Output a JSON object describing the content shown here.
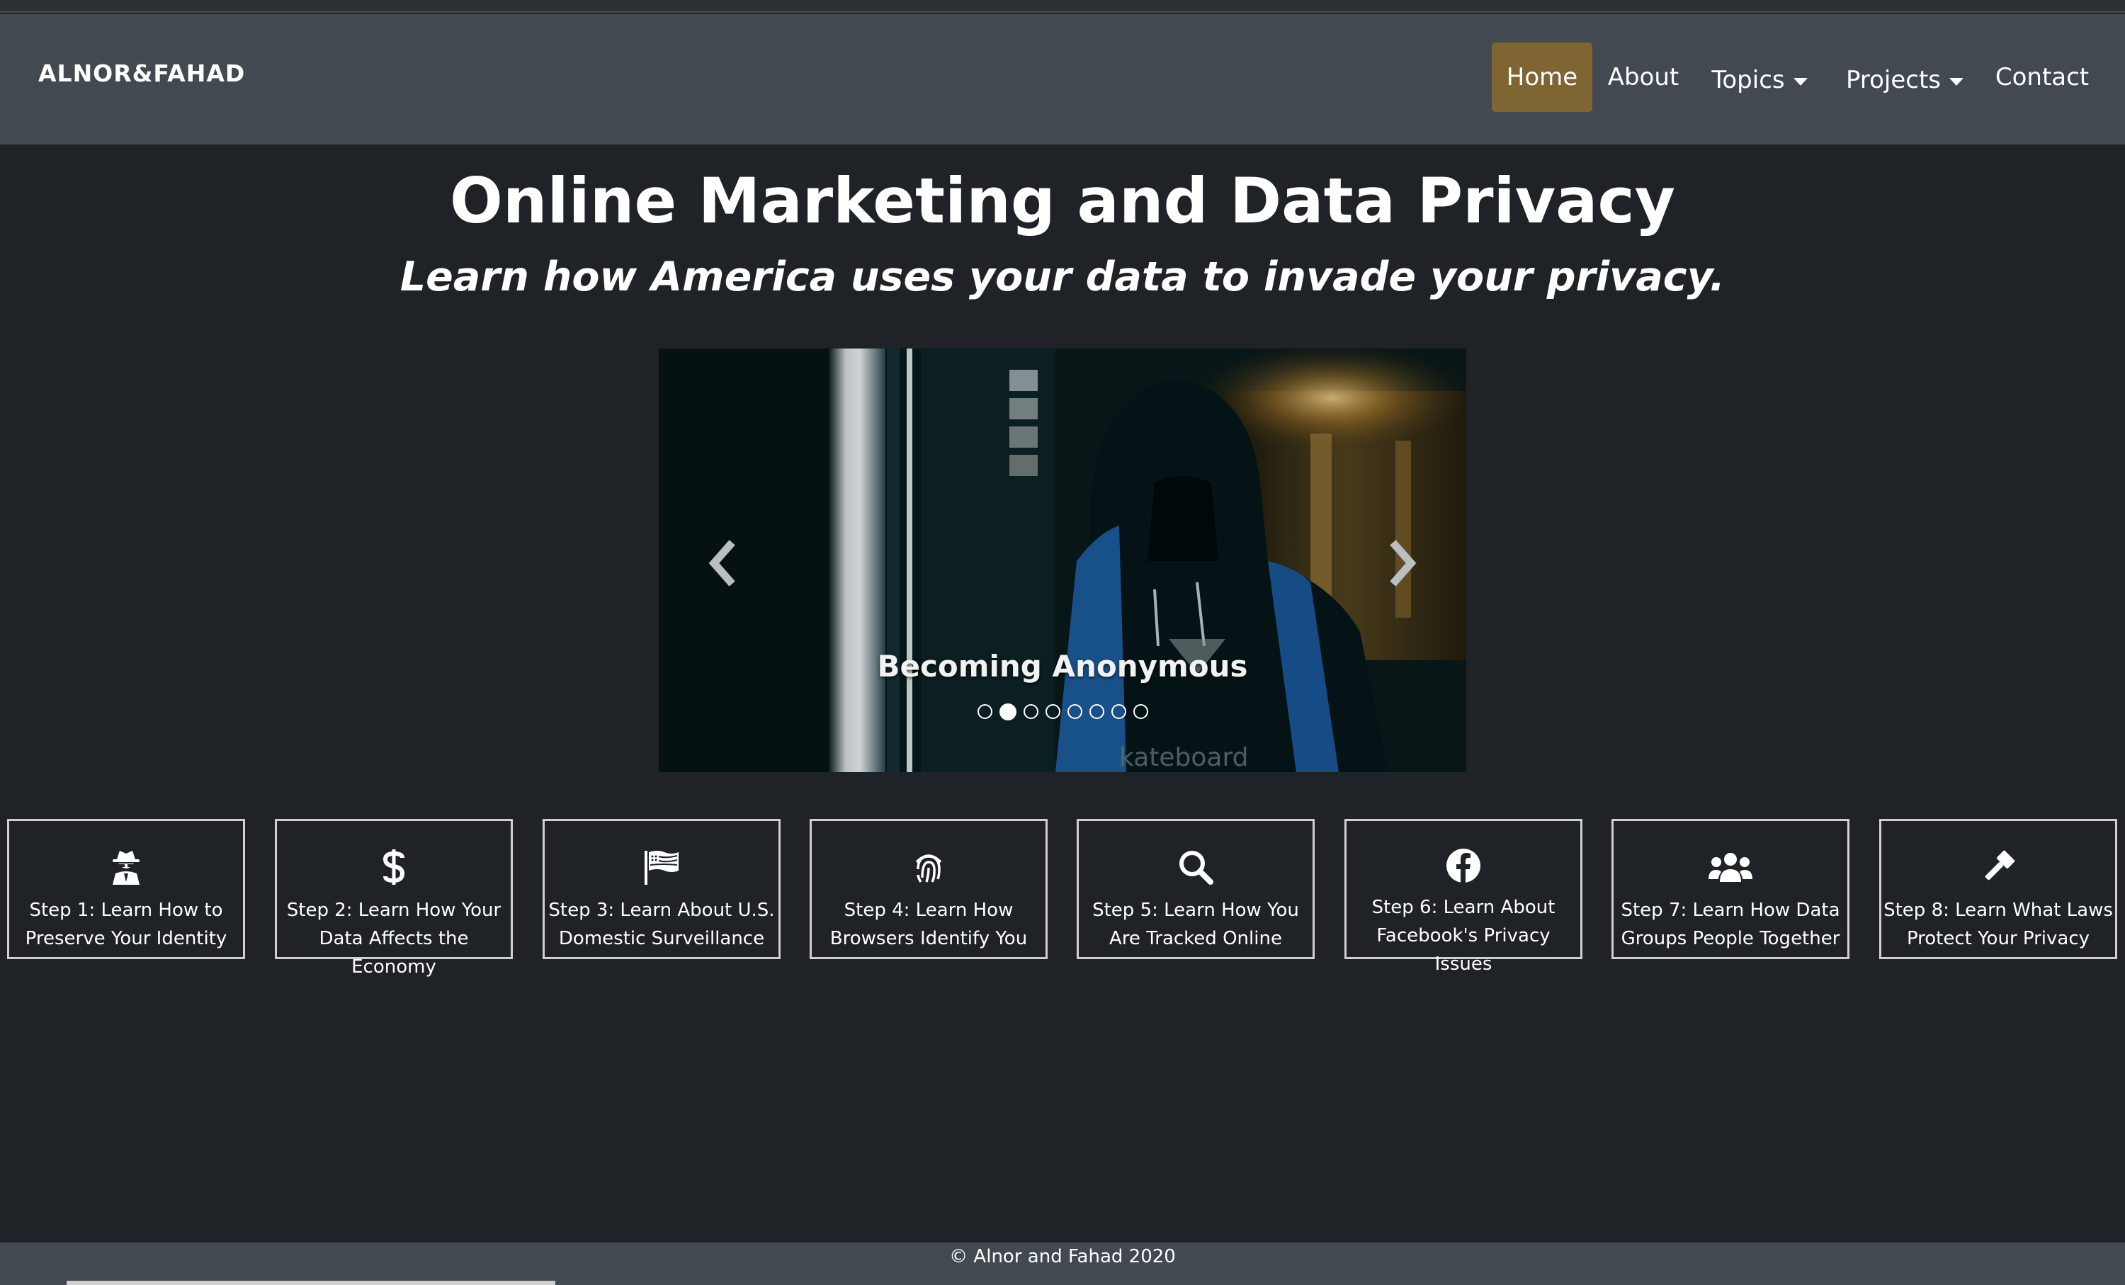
{
  "navbar": {
    "brand": "ALNOR&FAHAD",
    "items": [
      {
        "label": "Home",
        "active": true
      },
      {
        "label": "About",
        "active": false
      },
      {
        "label": "Topics",
        "dropdown": true
      },
      {
        "label": "Projects",
        "dropdown": true
      },
      {
        "label": "Contact",
        "active": false
      }
    ]
  },
  "hero": {
    "title": "Online Marketing and Data Privacy",
    "subtitle": "Learn how America uses your data to invade your privacy."
  },
  "carousel": {
    "caption": "Becoming Anonymous",
    "slide_count": 8,
    "active_index": 1,
    "image_text": "kateboard",
    "prev_icon": "chevron-left-icon",
    "next_icon": "chevron-right-icon"
  },
  "cards": [
    {
      "icon": "user-secret-icon",
      "label": "Step 1: Learn How to\nPreserve Your Identity"
    },
    {
      "icon": "dollar-sign-icon",
      "label": "Step 2: Learn How Your\nData Affects the Economy"
    },
    {
      "icon": "flag-usa-icon",
      "label": "Step 3: Learn About U.S.\nDomestic Surveillance"
    },
    {
      "icon": "fingerprint-icon",
      "label": "Step 4: Learn How\nBrowsers Identify You"
    },
    {
      "icon": "search-icon",
      "label": "Step 5: Learn How You\nAre Tracked Online"
    },
    {
      "icon": "facebook-icon",
      "label": "Step 6: Learn About\nFacebook's Privacy Issues"
    },
    {
      "icon": "users-icon",
      "label": "Step 7: Learn How Data\nGroups People Together"
    },
    {
      "icon": "gavel-icon",
      "label": "Step 8: Learn What Laws\nProtect Your Privacy"
    }
  ],
  "footer": {
    "text": "© Alnor and Fahad 2020"
  },
  "colors": {
    "background": "#1f2226",
    "navbar": "#434950",
    "active_nav": "#7e6531",
    "card_border": "#d0d0d0"
  }
}
